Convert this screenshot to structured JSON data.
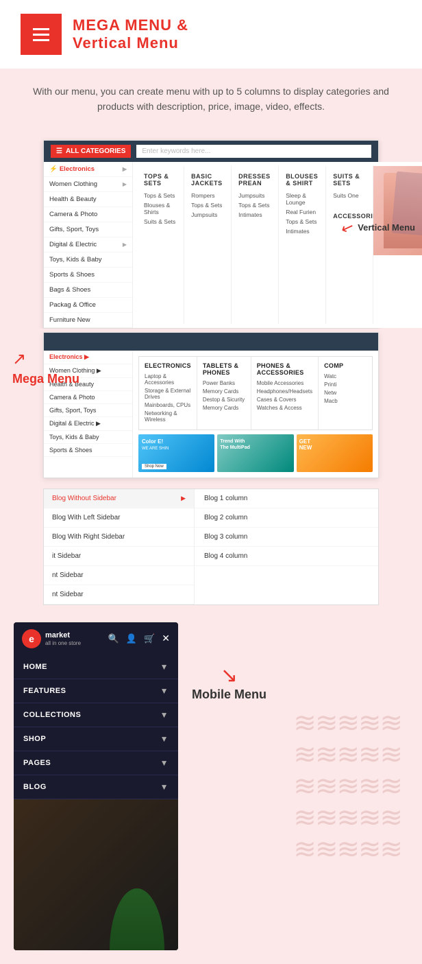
{
  "header": {
    "title_plain": "MEGA MENU &",
    "title_bold": "Vertical Menu",
    "logo_lines": [
      "",
      "",
      ""
    ]
  },
  "intro": {
    "text": "With our menu, you can create menu with up to 5 columns to display categories and products with description, price, image, video, effects."
  },
  "mockup": {
    "topbar": {
      "all_categories": "ALL CATEGORIES",
      "search_placeholder": "Enter keywords here..."
    },
    "sidebar_items": [
      {
        "label": "Electronics",
        "active": true,
        "has_arrow": true
      },
      {
        "label": "Women Clothing",
        "has_arrow": true
      },
      {
        "label": "Health & Beauty",
        "has_arrow": false
      },
      {
        "label": "Camera & Photo",
        "has_arrow": false
      },
      {
        "label": "Gifts, Sport, Toys",
        "has_arrow": false
      },
      {
        "label": "Digital & Electric",
        "has_arrow": true
      },
      {
        "label": "Toys, Kids & Baby",
        "has_arrow": false
      },
      {
        "label": "Sports & Shoes",
        "has_arrow": false
      },
      {
        "label": "Bags & Shoes",
        "has_arrow": false
      },
      {
        "label": "Packag & Office",
        "has_arrow": false
      },
      {
        "label": "Furniture New",
        "has_arrow": false
      }
    ],
    "mega_cols": [
      {
        "header": "TOPS & SETS",
        "items": [
          "Tops & Sets",
          "Blouses & Shirts",
          "Suits & Sets"
        ]
      },
      {
        "header": "BASIC JACKETS",
        "items": [
          "Rompers",
          "Tops & Sets",
          "Jumpsuits"
        ]
      },
      {
        "header": "DRESSES PREAN",
        "items": [
          "Jumpsuits",
          "Tops & Sets",
          "Intimates"
        ]
      },
      {
        "header": "BLOUSES & SHIRT",
        "items": [
          "Sleep & Lounge",
          "Real Furien",
          "Tops & Sets",
          "Intimates"
        ]
      },
      {
        "header": "SUITS & SETS",
        "items": [
          "Suits One"
        ]
      },
      {
        "header": "ACCESSORIES",
        "items": []
      }
    ]
  },
  "expanded_menu": {
    "cols": [
      {
        "title": "ELECTRONICS",
        "items": [
          "Laptop & Accessories",
          "Storage & External Drives",
          "Mainboards, CPUs",
          "Networking & Wireless"
        ]
      },
      {
        "title": "TABLETS & PHONES",
        "items": [
          "Power Banks",
          "Memory Cards",
          "Destop & Sicurity",
          "Memory Cards"
        ]
      },
      {
        "title": "PHONES & ACCESSORIES",
        "items": [
          "Mobile Accessories",
          "Headphones/Headsets",
          "Cases & Covers",
          "Watches & Access"
        ]
      },
      {
        "title": "COMP",
        "items": [
          "Watc",
          "Printi",
          "Netw",
          "Macb"
        ]
      }
    ],
    "images": [
      {
        "label": "Color E!",
        "sub": "WE ARE SHIN",
        "btn": "Shop Now",
        "type": "blue"
      },
      {
        "label": "Trend With The MultiPad",
        "type": "teal"
      },
      {
        "label": "GET NEW",
        "type": "orange"
      }
    ]
  },
  "blog_menu": {
    "left_items": [
      {
        "label": "Blog Without Sidebar",
        "active": true,
        "has_arrow": true
      },
      {
        "label": "Blog With Left Sidebar",
        "has_arrow": false
      },
      {
        "label": "Blog With Right Sidebar",
        "has_arrow": false
      },
      {
        "label": "it Sidebar",
        "has_arrow": false
      },
      {
        "label": "nt Sidebar",
        "has_arrow": false
      },
      {
        "label": "nt Sidebar",
        "has_arrow": false
      }
    ],
    "right_items": [
      "Blog 1 column",
      "Blog 2 column",
      "Blog 3 column",
      "Blog 4 column"
    ]
  },
  "section_labels": {
    "vertical_menu": "Vertical Menu",
    "mega_menu": "Mega Menu",
    "mobile_menu": "Mobile Menu"
  },
  "mobile": {
    "logo_text": "market",
    "logo_sub": "all in one store",
    "e_letter": "e",
    "nav_items": [
      {
        "label": "HOME"
      },
      {
        "label": "FEATURES"
      },
      {
        "label": "COLLECTIONS"
      },
      {
        "label": "SHOP"
      },
      {
        "label": "PAGES"
      },
      {
        "label": "BLOG"
      }
    ]
  }
}
